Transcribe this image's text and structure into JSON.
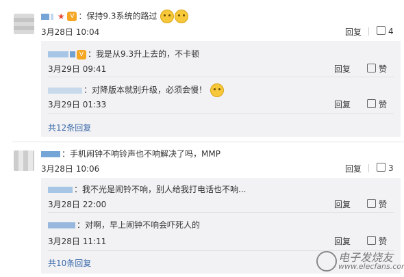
{
  "comments": [
    {
      "text": "：保持9.3系统的路过",
      "time": "3月28日 10:04",
      "reply_label": "回复",
      "like_count": "4",
      "replies": [
        {
          "text": "：我是从9.3升上去的，不卡顿",
          "time": "3月29日 09:41",
          "reply_label": "回复",
          "like_label": "赞"
        },
        {
          "text": "：对降版本就别升级，必须会慢！",
          "time": "3月29日 01:33",
          "reply_label": "回复",
          "like_label": "赞"
        }
      ],
      "more_label": "共12条回复"
    },
    {
      "text": "：手机闹钟不响铃声也不响解决了吗，MMP",
      "time": "3月28日 10:06",
      "reply_label": "回复",
      "like_count": "3",
      "replies": [
        {
          "text": "：我不光是闹铃不响，别人给我打电话也不响...",
          "time": "3月28日 22:00",
          "reply_label": "回复",
          "like_label": "赞"
        },
        {
          "text": "：对啊，早上闹钟不响会吓死人的",
          "time": "3月28日 11:11",
          "reply_label": "回复",
          "like_label": "赞"
        }
      ],
      "more_label": "共10条回复"
    }
  ],
  "watermark": {
    "cn": "电子发烧友",
    "url": "www.elecfans.com"
  },
  "colors": {
    "link": "#3b6aa9",
    "reply_bg": "#f2f2f5"
  },
  "icons": {
    "like": "thumbs-up-icon",
    "emoji": "cat-emoji-icon",
    "vip": "vip-badge-icon"
  }
}
